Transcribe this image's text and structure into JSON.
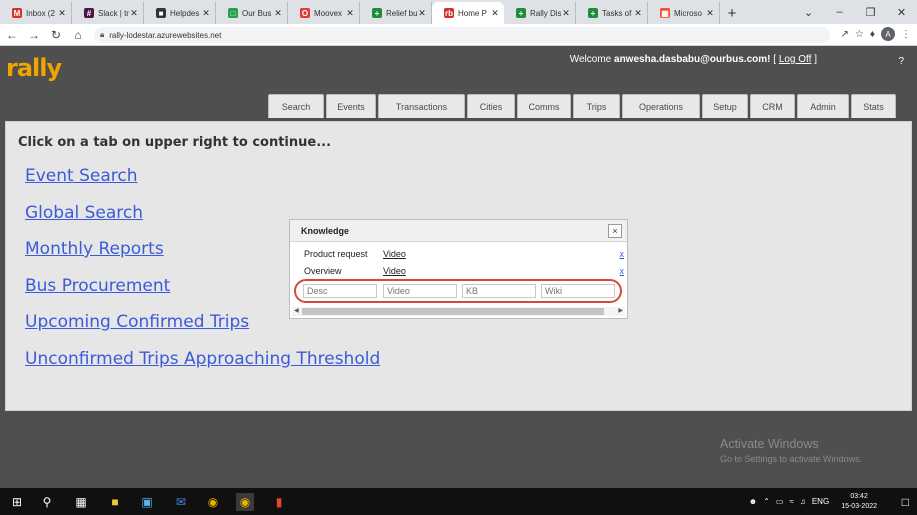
{
  "browser": {
    "tabs": [
      {
        "label": "Inbox (2",
        "icon": "gmail-icon",
        "color": "#d93025",
        "glyph": "M",
        "active": false
      },
      {
        "label": "Slack | tr",
        "icon": "slack-icon",
        "color": "#4a154b",
        "glyph": "#",
        "active": false
      },
      {
        "label": "Helpdes",
        "icon": "helpdesk-icon",
        "color": "#333333",
        "glyph": "■",
        "active": false
      },
      {
        "label": "Our Bus",
        "icon": "ourbus-icon",
        "color": "#22a04b",
        "glyph": "□",
        "active": false
      },
      {
        "label": "Moovex",
        "icon": "moovex-icon",
        "color": "#e53935",
        "glyph": "O",
        "active": false
      },
      {
        "label": "Relief bu",
        "icon": "sheets-icon",
        "color": "#1e8e3e",
        "glyph": "+",
        "active": false
      },
      {
        "label": "Home P",
        "icon": "redbus-icon",
        "color": "#d32f2f",
        "glyph": "rb",
        "active": true
      },
      {
        "label": "Rally Dis",
        "icon": "sheets-icon",
        "color": "#1e8e3e",
        "glyph": "+",
        "active": false
      },
      {
        "label": "Tasks of",
        "icon": "sheets-icon",
        "color": "#1e8e3e",
        "glyph": "+",
        "active": false
      },
      {
        "label": "Microso",
        "icon": "microsoft-icon",
        "color": "#f25022",
        "glyph": "▦",
        "active": false
      }
    ],
    "url": "rally-lodestar.azurewebsites.net",
    "profile_initial": "A"
  },
  "app": {
    "logo": "rally",
    "welcome_prefix": "Welcome ",
    "user_email": "anwesha.dasbabu@ourbus.com!",
    "logoff_open": " [ ",
    "logoff_label": "Log Off",
    "logoff_close": " ]",
    "help_label": "?",
    "nav_tabs": [
      {
        "label": "Search",
        "width": 56
      },
      {
        "label": "Events",
        "width": 50
      },
      {
        "label": "Transactions",
        "width": 87
      },
      {
        "label": "Cities",
        "width": 48
      },
      {
        "label": "Comms",
        "width": 54
      },
      {
        "label": "Trips",
        "width": 47
      },
      {
        "label": "Operations",
        "width": 78
      },
      {
        "label": "Setup",
        "width": 46
      },
      {
        "label": "CRM",
        "width": 45
      },
      {
        "label": "Admin",
        "width": 52
      },
      {
        "label": "Stats",
        "width": 45
      }
    ]
  },
  "main": {
    "intro": "Click on a tab on upper right to continue...",
    "links": [
      "Event Search",
      "Global Search",
      "Monthly Reports",
      "Bus Procurement",
      "Upcoming Confirmed Trips",
      "Unconfirmed Trips Approaching Threshold"
    ]
  },
  "knowledge": {
    "title": "Knowledge",
    "close": "×",
    "rows": [
      {
        "desc": "Product request",
        "video": "Video",
        "remove": "x"
      },
      {
        "desc": "Overview",
        "video": "Video",
        "remove": "x"
      }
    ],
    "inputs": {
      "desc_placeholder": "Desc",
      "video_placeholder": "Video",
      "kb_placeholder": "KB",
      "wiki_placeholder": "Wiki"
    }
  },
  "watermark": {
    "line1": "Activate Windows",
    "line2": "Go to Settings to activate Windows."
  },
  "taskbar": {
    "language": "ENG",
    "time": "03:42",
    "date": "15-03-2022"
  },
  "colors": {
    "accent_orange": "#f0a500",
    "link_blue": "#3b5bd8",
    "highlight_red": "#d24a3a"
  }
}
